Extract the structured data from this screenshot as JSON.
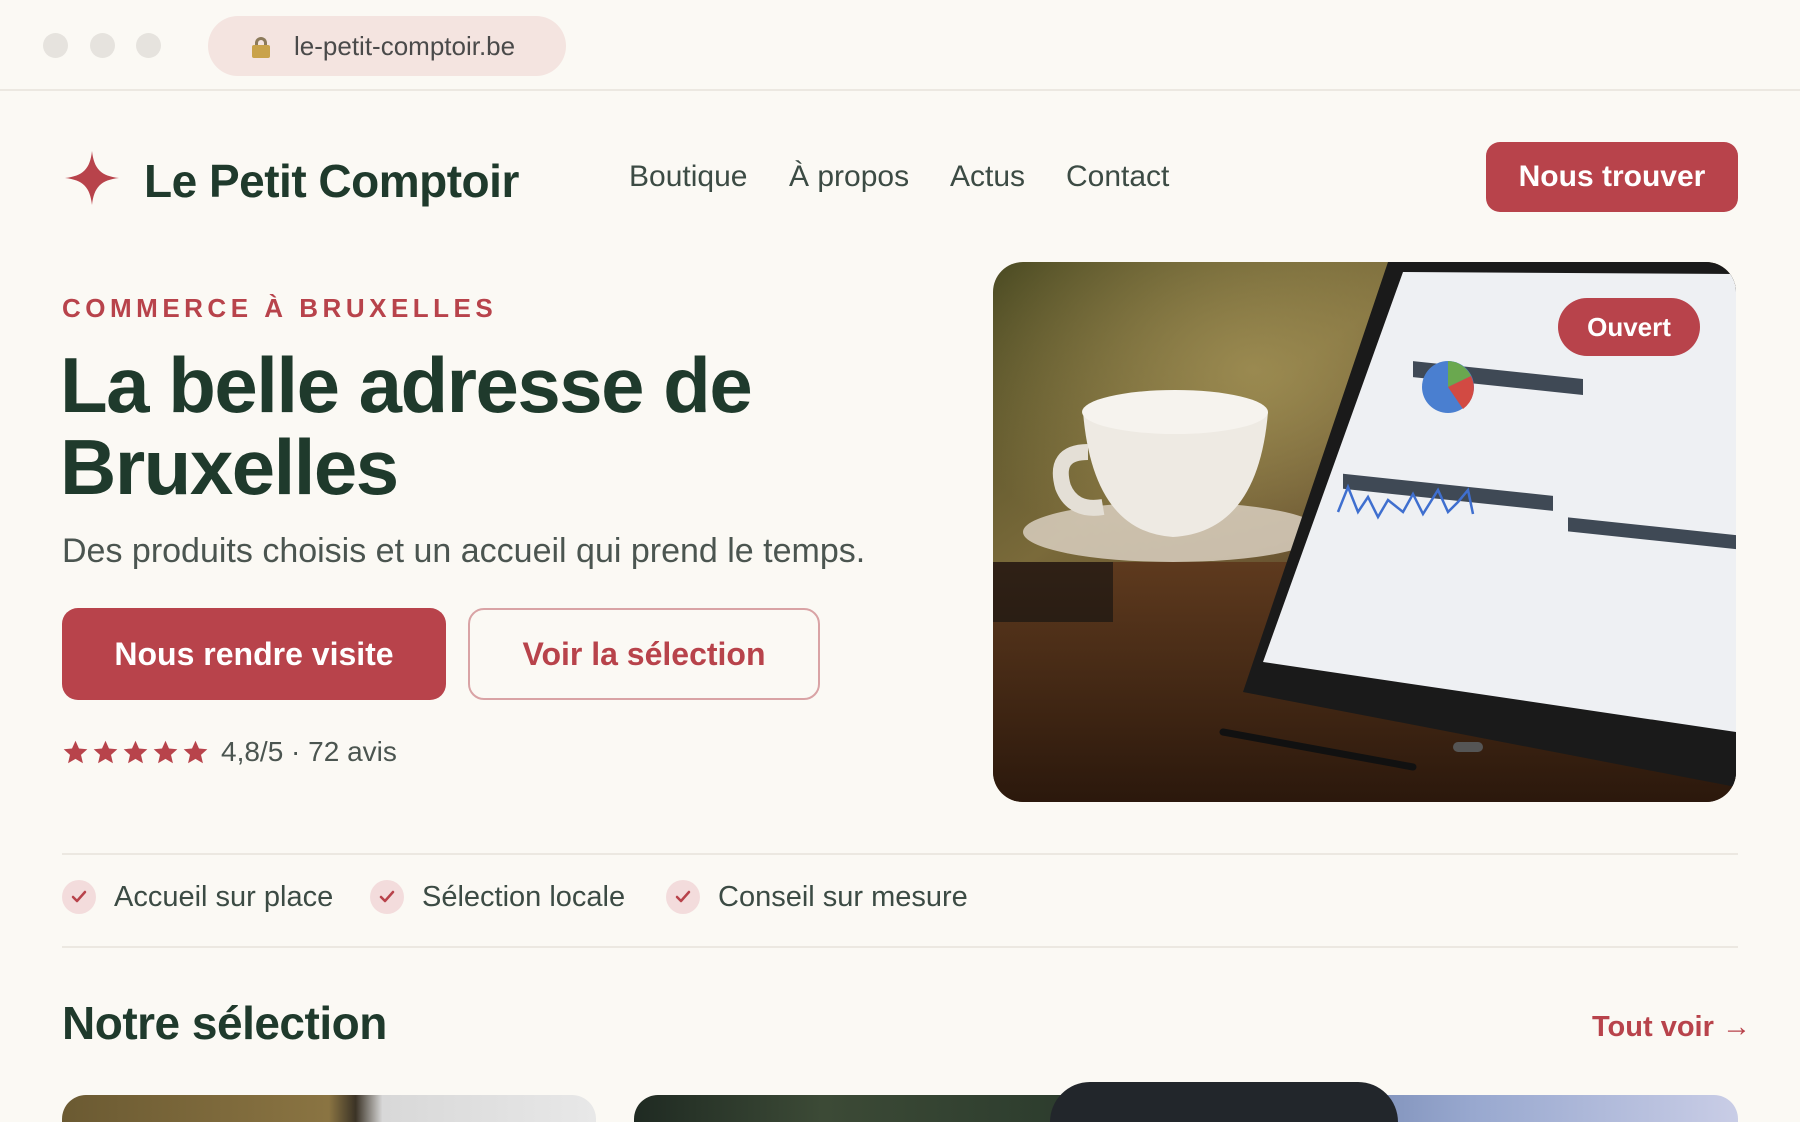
{
  "browser": {
    "url": "le-petit-comptoir.be"
  },
  "header": {
    "brand": "Le Petit Comptoir",
    "nav": [
      "Boutique",
      "À propos",
      "Actus",
      "Contact"
    ],
    "cta": "Nous trouver"
  },
  "hero": {
    "eyebrow": "COMMERCE À BRUXELLES",
    "title_line1": "La belle adresse de",
    "title_line2": "Bruxelles",
    "subtitle": "Des produits choisis et un accueil qui prend le temps.",
    "primary_button": "Nous rendre visite",
    "secondary_button": "Voir la sélection",
    "rating": {
      "stars": 5,
      "text": "4,8/5 · 72 avis"
    },
    "badge": "Ouvert",
    "image_icon": "tablet-analytics-photo"
  },
  "features": [
    {
      "label": "Accueil sur place",
      "icon": "check-icon"
    },
    {
      "label": "Sélection locale",
      "icon": "check-icon"
    },
    {
      "label": "Conseil sur mesure",
      "icon": "check-icon"
    }
  ],
  "selection": {
    "title": "Notre sélection",
    "see_all": "Tout voir →"
  },
  "colors": {
    "accent": "#b8434b",
    "heading": "#1f3a2c",
    "background": "#fbf9f4"
  }
}
